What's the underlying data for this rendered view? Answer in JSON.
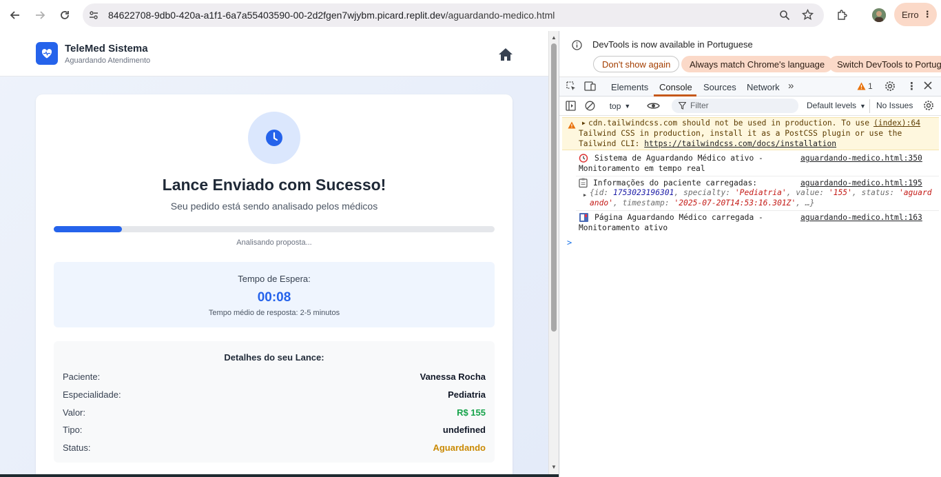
{
  "browser": {
    "url_host": "84622708-9db0-420a-a1f1-6a7a55403590-00-2d2fgen7wjybm.picard.replit.dev",
    "url_path": "/aguardando-medico.html",
    "profile_button": "Erro"
  },
  "app": {
    "brand_title": "TeleMed Sistema",
    "brand_subtitle": "Aguardando Atendimento",
    "headline": "Lance Enviado com Sucesso!",
    "subheadline": "Seu pedido está sendo analisado pelos médicos",
    "progress_fraction": 0.155,
    "progress_label": "Analisando proposta...",
    "wait": {
      "title": "Tempo de Espera:",
      "time": "00:08",
      "note": "Tempo médio de resposta: 2-5 minutos"
    },
    "details": {
      "title": "Detalhes do seu Lance:",
      "rows": [
        {
          "label": "Paciente:",
          "value": "Vanessa Rocha",
          "color": "#111827"
        },
        {
          "label": "Especialidade:",
          "value": "Pediatria",
          "color": "#111827"
        },
        {
          "label": "Valor:",
          "value": "R$ 155",
          "color": "#16a34a"
        },
        {
          "label": "Tipo:",
          "value": "undefined",
          "color": "#111827"
        },
        {
          "label": "Status:",
          "value": "Aguardando",
          "color": "#ca8a04"
        }
      ]
    },
    "accent": "#2563eb"
  },
  "devtools": {
    "info_text": "DevTools is now available in Portuguese",
    "info_buttons": [
      "Don't show again",
      "Always match Chrome's language",
      "Switch DevTools to Portuguese"
    ],
    "tabs": [
      "Elements",
      "Console",
      "Sources",
      "Network"
    ],
    "issue_count": "1",
    "context": "top",
    "filter_placeholder": "Filter",
    "levels": "Default levels",
    "issues": "No Issues",
    "warning": {
      "line1": "cdn.tailwindcss.com should not be used in production. To use",
      "line2": "Tailwind CSS in production, install it as a PostCSS plugin or use the",
      "line3": "Tailwind CLI: ",
      "link": "https://tailwindcss.com/docs/installation",
      "source": "(index):64"
    },
    "log1": {
      "line1": "Sistema de Aguardando Médico ativo -",
      "line2": "Monitoramento em tempo real",
      "source": "aguardando-medico.html:350"
    },
    "log2": {
      "line1": "Informações do paciente carregadas:",
      "source": "aguardando-medico.html:195",
      "id": "1753023196301",
      "specialty": "'Pediatria'",
      "value": "'155'",
      "status_a": "'aguard",
      "status_b": "ando'",
      "timestamp": "'2025-07-20T14:53:16.301Z'"
    },
    "log3": {
      "line1": "Página Aguardando Médico carregada -",
      "line2": "Monitoramento ativo",
      "source": "aguardando-medico.html:163"
    },
    "prompt": ">"
  }
}
